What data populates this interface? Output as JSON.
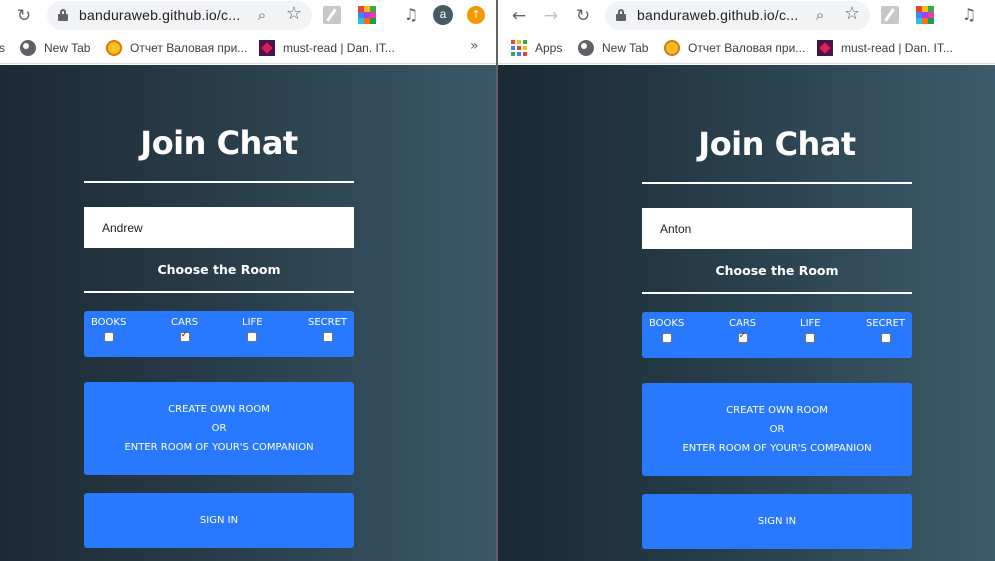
{
  "windows": [
    {
      "url": "banduraweb.github.io/c...",
      "bookmarks": [
        {
          "label": "s",
          "icon": "none"
        },
        {
          "label": "New Tab",
          "icon": "globe-icon"
        },
        {
          "label": "Отчет Валовая при...",
          "icon": "smile-icon"
        },
        {
          "label": "must-read | Dan. IT...",
          "icon": "mustread-icon"
        }
      ],
      "more": "»",
      "avatar": "a",
      "form": {
        "title": "Join Chat",
        "name_value": "Andrew",
        "choose_room": "Choose the Room",
        "rooms": [
          {
            "label": "BOOKS",
            "checked": false
          },
          {
            "label": "CARS",
            "checked": true
          },
          {
            "label": "LIFE",
            "checked": false
          },
          {
            "label": "SECRET",
            "checked": false
          }
        ],
        "create_line1": "CREATE OWN ROOM",
        "create_line2": "OR",
        "create_line3": "ENTER ROOM OF YOUR'S COMPANION",
        "sign_in": "SIGN IN"
      }
    },
    {
      "url": "banduraweb.github.io/c...",
      "bookmarks": [
        {
          "label": "Apps",
          "icon": "apps-icon"
        },
        {
          "label": "New Tab",
          "icon": "globe-icon"
        },
        {
          "label": "Отчет Валовая при...",
          "icon": "smile-icon"
        },
        {
          "label": "must-read | Dan. IT...",
          "icon": "mustread-icon"
        }
      ],
      "form": {
        "title": "Join Chat",
        "name_value": "Anton",
        "choose_room": "Choose the Room",
        "rooms": [
          {
            "label": "BOOKS",
            "checked": false
          },
          {
            "label": "CARS",
            "checked": true
          },
          {
            "label": "LIFE",
            "checked": false
          },
          {
            "label": "SECRET",
            "checked": false
          }
        ],
        "create_line1": "CREATE OWN ROOM",
        "create_line2": "OR",
        "create_line3": "ENTER ROOM OF YOUR'S COMPANION",
        "sign_in": "SIGN IN"
      }
    }
  ],
  "colors": {
    "accent": "#2979ff",
    "update_badge": "#f29900"
  }
}
